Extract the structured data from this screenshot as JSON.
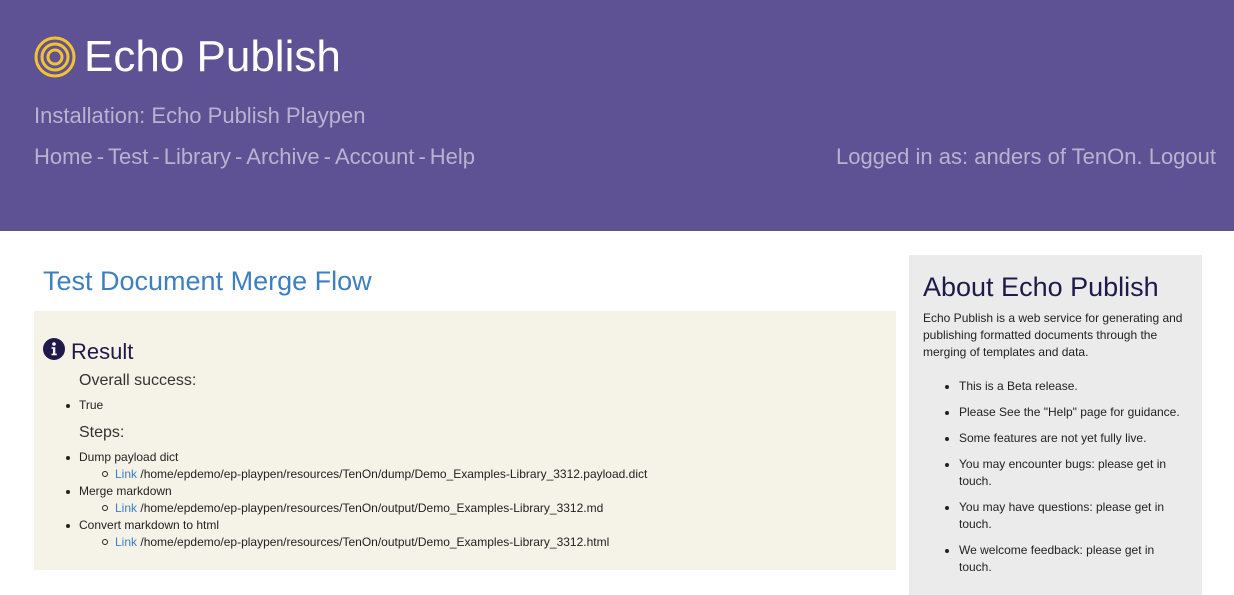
{
  "header": {
    "brand": "Echo Publish",
    "installation": "Installation: Echo Publish Playpen",
    "nav": [
      {
        "label": "Home"
      },
      {
        "label": "Test"
      },
      {
        "label": "Library"
      },
      {
        "label": "Archive"
      },
      {
        "label": "Account"
      },
      {
        "label": "Help"
      }
    ],
    "nav_separator": "-",
    "logged_in_text": "Logged in as: anders of TenOn.",
    "logout_label": "Logout",
    "logo_icon": "concentric-circles-logo-icon",
    "colors": {
      "background": "#5e5294",
      "logo": "#f2c230"
    }
  },
  "main": {
    "title": "Test Document Merge Flow",
    "result": {
      "icon": "info-icon",
      "title": "Result",
      "overall_label": "Overall success:",
      "overall_value": "True",
      "steps_label": "Steps:",
      "steps": [
        {
          "name": "Dump payload dict",
          "link_label": "Link",
          "path": "/home/epdemo/ep-playpen/resources/TenOn/dump/Demo_Examples-Library_3312.payload.dict"
        },
        {
          "name": "Merge markdown",
          "link_label": "Link",
          "path": "/home/epdemo/ep-playpen/resources/TenOn/output/Demo_Examples-Library_3312.md"
        },
        {
          "name": "Convert markdown to html",
          "link_label": "Link",
          "path": "/home/epdemo/ep-playpen/resources/TenOn/output/Demo_Examples-Library_3312.html"
        }
      ]
    }
  },
  "sidebar": {
    "title": "About Echo Publish",
    "description": "Echo Publish is a web service for generating and publishing formatted documents through the merging of templates and data.",
    "items": [
      "This is a Beta release.",
      "Please See the \"Help\" page for guidance.",
      "Some features are not yet fully live.",
      "You may encounter bugs: please get in touch.",
      "You may have questions: please get in touch.",
      "We welcome feedback: please get in touch."
    ]
  }
}
